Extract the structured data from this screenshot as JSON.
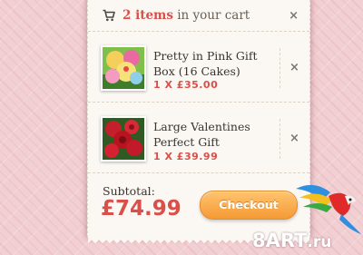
{
  "cart": {
    "header": {
      "count": "2 items",
      "suffix": " in your cart"
    },
    "items": [
      {
        "name": "Pretty in Pink Gift Box (16 Cakes)",
        "price": "1 X £35.00",
        "image": "cupcakes-photo"
      },
      {
        "name": "Large Valentines Perfect Gift",
        "price": "1 X £39.99",
        "image": "roses-photo"
      }
    ],
    "footer": {
      "subtotal_label": "Subtotal:",
      "subtotal_value": "£74.99",
      "checkout_label": "Checkout"
    }
  },
  "watermark": {
    "brand": "8ART",
    "domain": ".ru"
  },
  "icons": {
    "close": "×",
    "cart": "cart-icon"
  },
  "colors": {
    "accent": "#d94f4a",
    "button": "#f59a36",
    "background": "#f2cfd2"
  }
}
